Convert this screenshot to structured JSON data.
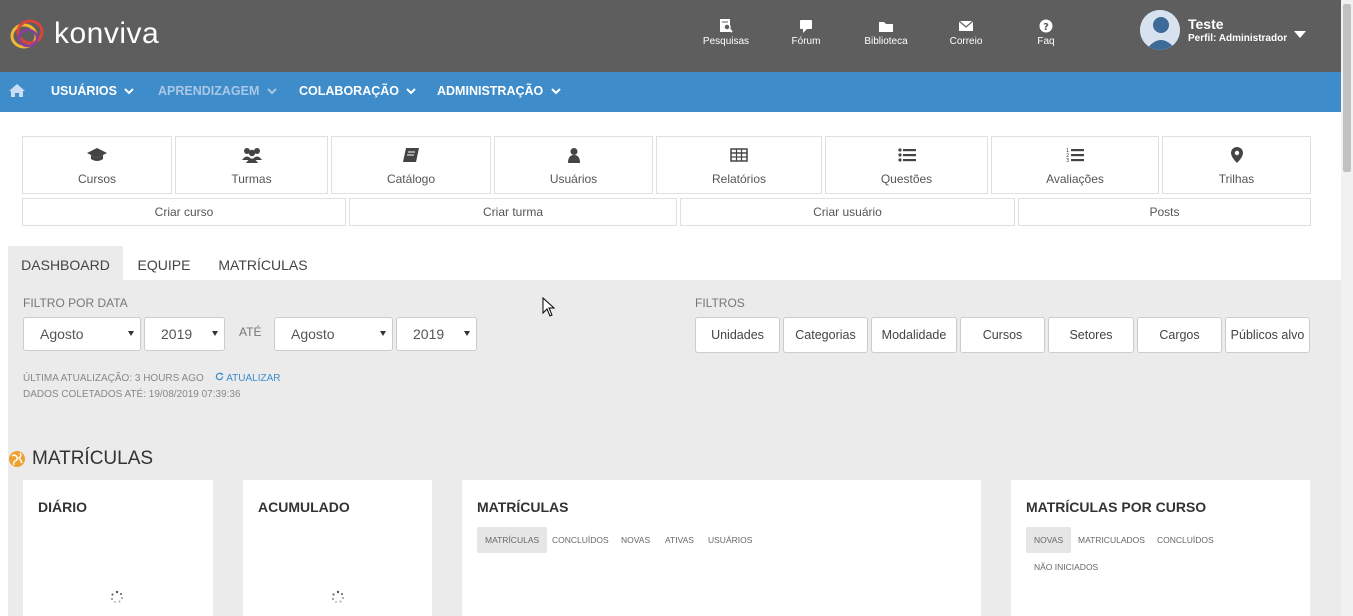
{
  "brand": {
    "name": "konviva"
  },
  "top_nav": [
    {
      "label": "Pesquisas",
      "icon": "search-doc-icon"
    },
    {
      "label": "Fórum",
      "icon": "chat-icon"
    },
    {
      "label": "Biblioteca",
      "icon": "folder-icon"
    },
    {
      "label": "Correio",
      "icon": "envelope-icon"
    },
    {
      "label": "Faq",
      "icon": "question-icon"
    }
  ],
  "user": {
    "name": "Teste",
    "profile": "Perfil: Administrador"
  },
  "main_nav": [
    {
      "label": "USUÁRIOS"
    },
    {
      "label": "APRENDIZAGEM"
    },
    {
      "label": "COLABORAÇÃO"
    },
    {
      "label": "ADMINISTRAÇÃO"
    }
  ],
  "tiles": [
    {
      "label": "Cursos",
      "icon": "graduation-cap-icon"
    },
    {
      "label": "Turmas",
      "icon": "users-icon"
    },
    {
      "label": "Catálogo",
      "icon": "book-icon"
    },
    {
      "label": "Usuários",
      "icon": "user-icon"
    },
    {
      "label": "Relatórios",
      "icon": "table-icon"
    },
    {
      "label": "Questões",
      "icon": "list-icon"
    },
    {
      "label": "Avaliações",
      "icon": "ordered-list-icon"
    },
    {
      "label": "Trilhas",
      "icon": "map-marker-icon"
    }
  ],
  "actions": [
    {
      "label": "Criar curso"
    },
    {
      "label": "Criar turma"
    },
    {
      "label": "Criar usuário"
    },
    {
      "label": "Posts"
    }
  ],
  "tabs": [
    {
      "label": "DASHBOARD",
      "active": true
    },
    {
      "label": "EQUIPE",
      "active": false
    },
    {
      "label": "MATRÍCULAS",
      "active": false
    }
  ],
  "date_filter": {
    "label": "FILTRO POR DATA",
    "from_month": "Agosto",
    "from_year": "2019",
    "until_label": "ATÉ",
    "to_month": "Agosto",
    "to_year": "2019"
  },
  "filters": {
    "label": "FILTROS",
    "buttons": [
      "Unidades",
      "Categorias",
      "Modalidade",
      "Cursos",
      "Setores",
      "Cargos",
      "Públicos alvo"
    ]
  },
  "status": {
    "last_update": "ÚLTIMA ATUALIZAÇÃO: 3 HOURS AGO",
    "refresh_label": "ATUALIZAR",
    "collected": "DADOS COLETADOS ATÉ: 19/08/2019 07:39:36"
  },
  "section": {
    "title": "MATRÍCULAS"
  },
  "cards": {
    "diario": {
      "title": "DIÁRIO"
    },
    "acumulado": {
      "title": "ACUMULADO"
    },
    "matriculas": {
      "title": "MATRÍCULAS",
      "pills": [
        "MATRÍCULAS",
        "CONCLUÍDOS",
        "NOVAS",
        "ATIVAS",
        "USUÁRIOS"
      ]
    },
    "por_curso": {
      "title": "MATRÍCULAS POR CURSO",
      "pills": [
        "NOVAS",
        "MATRICULADOS",
        "CONCLUÍDOS",
        "NÃO INICIADOS"
      ]
    }
  },
  "colors": {
    "header_bg": "#5e5e5e",
    "nav_bg": "#3f8ccb",
    "panel_bg": "#ebebeb",
    "accent_orange": "#f0a030"
  }
}
